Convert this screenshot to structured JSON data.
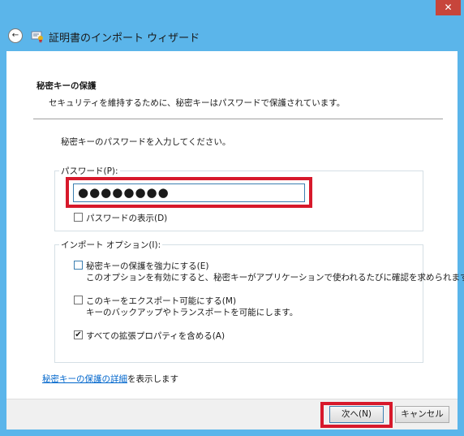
{
  "window": {
    "title": "証明書のインポート ウィザード",
    "close_glyph": "✕",
    "back_glyph": "←"
  },
  "header": {
    "title": "秘密キーの保護",
    "subtitle": "セキュリティを維持するために、秘密キーはパスワードで保護されています。"
  },
  "main": {
    "instruction": "秘密キーのパスワードを入力してください。",
    "password_group_label": "パスワード(P):",
    "password_value": "●●●●●●●●",
    "show_password_label": "パスワードの表示(D)",
    "show_password_checked": false,
    "import_group_label": "インポート オプション(I):",
    "options": [
      {
        "label": "秘密キーの保護を強力にする(E)",
        "desc": "このオプションを有効にすると、秘密キーがアプリケーションで使われるたびに確認を求められます。",
        "checked": false
      },
      {
        "label": "このキーをエクスポート可能にする(M)",
        "desc": "キーのバックアップやトランスポートを可能にします。",
        "checked": false
      },
      {
        "label": "すべての拡張プロパティを含める(A)",
        "desc": "",
        "checked": true
      }
    ],
    "footer_link": "秘密キーの保護の詳細",
    "footer_link_suffix": "を表示します"
  },
  "buttons": {
    "next": "次へ(N)",
    "cancel": "キャンセル"
  },
  "colors": {
    "frame": "#5bb5ea",
    "highlight": "#d7192b",
    "close": "#c7453b"
  }
}
